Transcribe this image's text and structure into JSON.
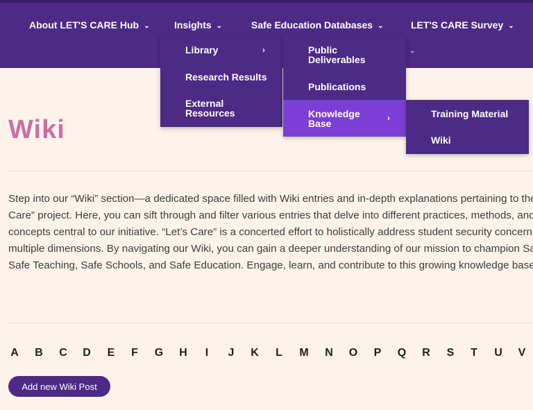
{
  "nav": {
    "items": [
      {
        "label": "About LET'S CARE Hub"
      },
      {
        "label": "Insights"
      },
      {
        "label": "Safe Education Databases"
      },
      {
        "label": "LET'S CARE Survey"
      }
    ],
    "chevron": "⌄",
    "submenu_arrow": "›"
  },
  "menus": {
    "insights": [
      "Library",
      "Research Results",
      "External Resources"
    ],
    "databases": [
      "Public Deliverables",
      "Publications",
      "Knowledge Base"
    ],
    "knowledge_base": [
      "Training Material",
      "Wiki"
    ]
  },
  "page": {
    "title": "Wiki",
    "intro_lines": [
      "Step into our “Wiki” section—a dedicated space filled with Wiki entries and in-depth explanations pertaining to the “Let’s",
      "Care” project. Here, you can sift through and filter various entries that delve into different practices, methods, and",
      "concepts central to our initiative. “Let’s Care” is a concerted effort to holistically address student security concerns across",
      "multiple dimensions. By navigating our Wiki, you can gain a deeper understanding of our mission to champion Safe Learning,",
      "Safe Teaching, Safe Schools, and Safe Education. Engage, learn, and contribute to this growing knowledge base."
    ]
  },
  "alphabet": [
    "A",
    "B",
    "C",
    "D",
    "E",
    "F",
    "G",
    "H",
    "I",
    "J",
    "K",
    "L",
    "M",
    "N",
    "O",
    "P",
    "Q",
    "R",
    "S",
    "T",
    "U",
    "V"
  ],
  "add_button": "Add new Wiki Post",
  "colors": {
    "nav_bg": "#4c2a85",
    "active_menu": "#7b3fd6",
    "title": "#c96fa5",
    "page_bg": "#fdf3ea"
  }
}
